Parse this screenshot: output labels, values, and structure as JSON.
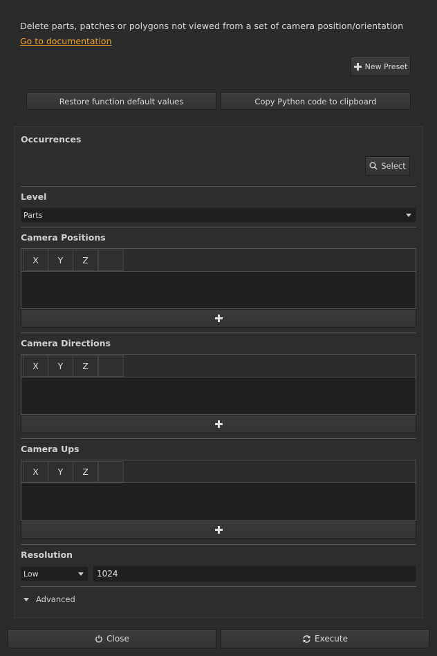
{
  "header": {
    "description": "Delete parts, patches or polygons not viewed from a set of camera position/orientation",
    "doc_link": "Go to documentation"
  },
  "toolbar": {
    "new_preset": "New Preset",
    "restore_defaults": "Restore function default values",
    "copy_python": "Copy Python code to clipboard"
  },
  "occurrences": {
    "title": "Occurrences",
    "select_label": "Select"
  },
  "level": {
    "title": "Level",
    "value": "Parts"
  },
  "camera_positions": {
    "title": "Camera Positions",
    "columns": [
      "X",
      "Y",
      "Z",
      ""
    ]
  },
  "camera_directions": {
    "title": "Camera Directions",
    "columns": [
      "X",
      "Y",
      "Z",
      ""
    ]
  },
  "camera_ups": {
    "title": "Camera Ups",
    "columns": [
      "X",
      "Y",
      "Z",
      ""
    ]
  },
  "resolution": {
    "title": "Resolution",
    "preset": "Low",
    "value": "1024"
  },
  "advanced_label": "Advanced",
  "footer": {
    "close_label": "Close",
    "execute_label": "Execute"
  },
  "icons": {
    "new_preset": "plus-icon",
    "select": "search-icon",
    "add_row": "plus-icon",
    "close": "power-icon",
    "execute": "refresh-icon"
  },
  "colors": {
    "link": "#f0a030",
    "background": "#2b2b2b"
  }
}
